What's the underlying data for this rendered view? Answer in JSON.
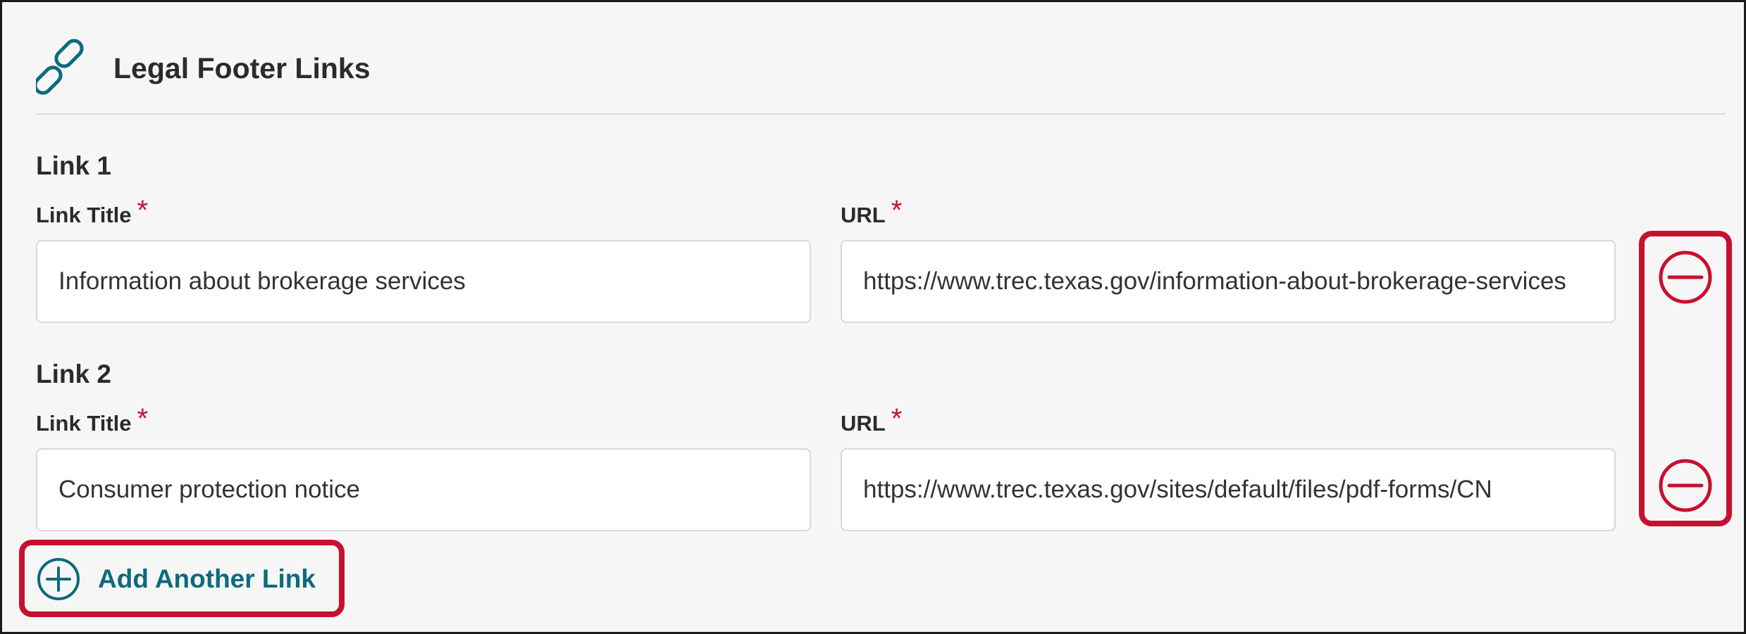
{
  "section": {
    "title": "Legal Footer Links",
    "icon": "link-icon"
  },
  "colors": {
    "accent": "#0d6a7d",
    "required": "#c8102e",
    "highlight": "#c8102e"
  },
  "links": [
    {
      "heading": "Link 1",
      "title_label": "Link Title",
      "url_label": "URL",
      "required_mark": "*",
      "title_value": "Information about brokerage services",
      "url_value": "https://www.trec.texas.gov/information-about-brokerage-services"
    },
    {
      "heading": "Link 2",
      "title_label": "Link Title",
      "url_label": "URL",
      "required_mark": "*",
      "title_value": "Consumer protection notice",
      "url_value": "https://www.trec.texas.gov/sites/default/files/pdf-forms/CN"
    }
  ],
  "actions": {
    "add_label": "Add Another Link",
    "add_icon": "plus-circle-icon",
    "remove_icon": "minus-circle-icon"
  }
}
